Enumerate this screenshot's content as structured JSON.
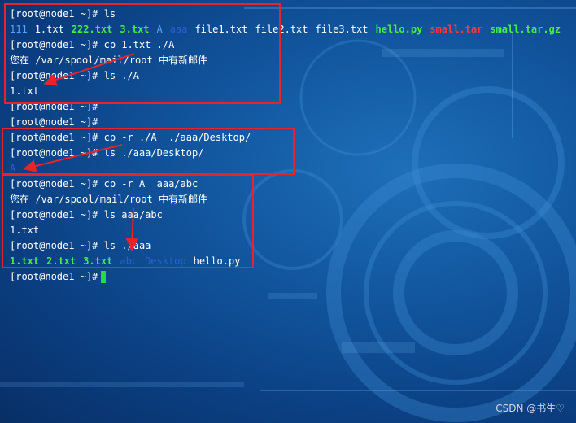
{
  "terminal": {
    "lines": [
      {
        "prompt": "[root@node1 ~]#",
        "cmd": " ls"
      },
      {
        "files": [
          {
            "name": "111",
            "color": "blue"
          },
          {
            "name": "1.txt",
            "color": "white"
          },
          {
            "name": "222.txt",
            "color": "green"
          },
          {
            "name": "3.txt",
            "color": "green"
          },
          {
            "name": "A",
            "color": "blue"
          },
          {
            "name": "aaa",
            "color": "dir"
          },
          {
            "name": "file1.txt",
            "color": "white"
          },
          {
            "name": "file2.txt",
            "color": "white"
          },
          {
            "name": "file3.txt",
            "color": "white"
          },
          {
            "name": "hello.py",
            "color": "green"
          },
          {
            "name": "small.tar",
            "color": "red"
          },
          {
            "name": "small.tar.gz",
            "color": "green"
          }
        ]
      },
      {
        "prompt": "[root@node1 ~]#",
        "cmd": " cp 1.txt ./A"
      },
      {
        "text": "您在 /var/spool/mail/root 中有新邮件"
      },
      {
        "prompt": "[root@node1 ~]#",
        "cmd": " ls ./A"
      },
      {
        "text": "1.txt"
      },
      {
        "prompt": "[root@node1 ~]#",
        "cmd": ""
      },
      {
        "prompt": "[root@node1 ~]#",
        "cmd": ""
      },
      {
        "prompt": "[root@node1 ~]#",
        "cmd": " cp -r ./A  ./aaa/Desktop/"
      },
      {
        "prompt": "[root@node1 ~]#",
        "cmd": " ls ./aaa/Desktop/"
      },
      {
        "files": [
          {
            "name": "A",
            "color": "dir"
          }
        ]
      },
      {
        "prompt": "[root@node1 ~]#",
        "cmd": " cp -r A  aaa/abc"
      },
      {
        "text": "您在 /var/spool/mail/root 中有新邮件"
      },
      {
        "prompt": "[root@node1 ~]#",
        "cmd": " ls aaa/abc"
      },
      {
        "text": "1.txt"
      },
      {
        "prompt": "[root@node1 ~]#",
        "cmd": " ls ./aaa"
      },
      {
        "files": [
          {
            "name": "1.txt",
            "color": "green"
          },
          {
            "name": "2.txt",
            "color": "green"
          },
          {
            "name": "3.txt",
            "color": "green"
          },
          {
            "name": "abc",
            "color": "dir"
          },
          {
            "name": "Desktop",
            "color": "dir"
          },
          {
            "name": "hello.py",
            "color": "white"
          }
        ]
      },
      {
        "prompt": "[root@node1 ~]#",
        "cmd": "",
        "cursor": true
      }
    ]
  },
  "colors": {
    "box": "#e8232a",
    "cursor": "#22dd44"
  },
  "watermark": "CSDN @书生♡"
}
